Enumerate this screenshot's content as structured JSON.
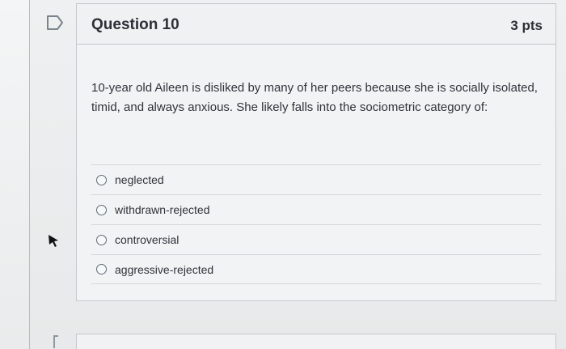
{
  "question": {
    "title": "Question 10",
    "points": "3 pts",
    "prompt": "10-year old Aileen is disliked by many of her peers because she is socially isolated, timid, and always anxious. She likely falls into the sociometric category of:",
    "options": [
      {
        "label": "neglected"
      },
      {
        "label": "withdrawn-rejected"
      },
      {
        "label": "controversial"
      },
      {
        "label": "aggressive-rejected"
      }
    ]
  },
  "icons": {
    "flag": "flag-question-icon",
    "pointer": "mouse-pointer-icon"
  },
  "colors": {
    "background": "#eceeef",
    "card": "#f2f3f4",
    "border": "#c6c9cc",
    "text": "#2f343a",
    "radio": "#5e6d78"
  }
}
